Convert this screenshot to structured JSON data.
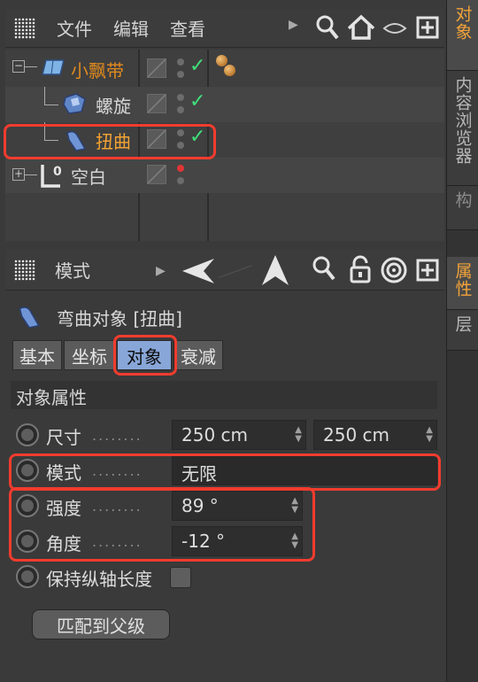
{
  "obj_toolbar": {
    "menus": [
      "文件",
      "编辑",
      "查看"
    ]
  },
  "objects": [
    {
      "name": "小飘带",
      "color": "#e08a1e"
    },
    {
      "name": "螺旋",
      "color": "#d6d6d6"
    },
    {
      "name": "扭曲",
      "color": "#f3a335"
    },
    {
      "name": "空白",
      "color": "#d6d6d6"
    }
  ],
  "attr_toolbar": {
    "mode_label": "模式"
  },
  "attr": {
    "title": "弯曲对象 [扭曲]",
    "tabs": [
      "基本",
      "坐标",
      "对象",
      "衰减"
    ],
    "active_tab": "对象",
    "section": "对象属性",
    "size_label": "尺寸",
    "size_x": "250 cm",
    "size_y": "250 cm",
    "mode_label": "模式",
    "mode_value": "无限",
    "strength_label": "强度",
    "strength_value": "89 °",
    "angle_label": "角度",
    "angle_value": "-12 °",
    "keep_length_label": "保持纵轴长度",
    "match_parent_button": "匹配到父级",
    "dots": "........"
  },
  "side_tabs": [
    "对象",
    "内容浏览器",
    "构",
    "属性",
    "层"
  ],
  "colors": {
    "accent": "#f2a33a",
    "highlight_box": "#f23c2e",
    "active_tab": "#88a6d8"
  }
}
